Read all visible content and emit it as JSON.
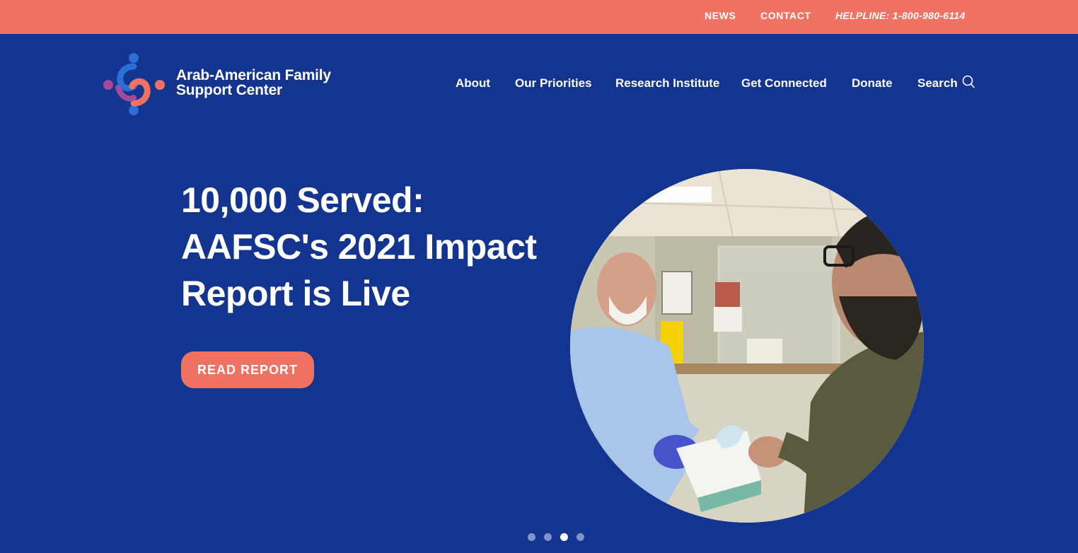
{
  "topbar": {
    "news": "NEWS",
    "contact": "CONTACT",
    "helpline": "HELPLINE: 1-800-980-6114",
    "bg_color": "#f07263"
  },
  "header": {
    "logo_line1": "Arab-American Family",
    "logo_line2": "Support Center",
    "nav": {
      "about": "About",
      "priorities": "Our Priorities",
      "research": "Research Institute",
      "connected": "Get Connected",
      "donate": "Donate",
      "search": "Search"
    },
    "search_icon": "search-icon",
    "bg_color": "#13358f"
  },
  "hero": {
    "title_line1": "10,000 Served:",
    "title_line2": "AAFSC's 2021 Impact",
    "title_line3": "Report is Live",
    "cta": "READ REPORT",
    "cta_color": "#f07263",
    "image_alt": "Staff member handing a box of face masks to a visitor"
  },
  "carousel": {
    "slide_count": 4,
    "active_index": 3
  }
}
